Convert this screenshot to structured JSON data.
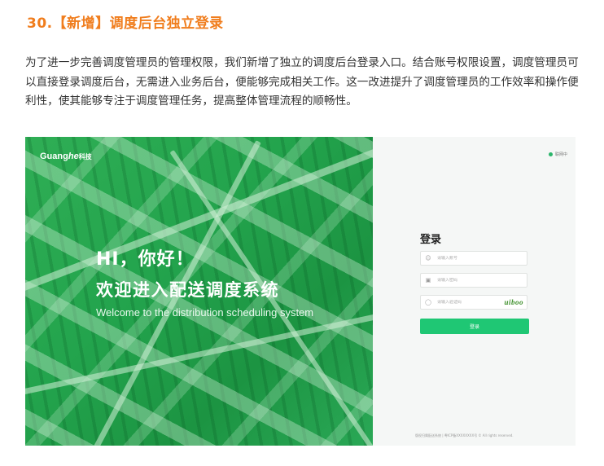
{
  "section": {
    "title": "30.【新增】调度后台独立登录",
    "intro": "为了进一步完善调度管理员的管理权限，我们新增了独立的调度后台登录入口。结合账号权限设置，调度管理员可以直接登录调度后台，无需进入业务后台，便能够完成相关工作。这一改进提升了调度管理员的工作效率和操作便利性，使其能够专注于调度管理任务，提高整体管理流程的顺畅性。"
  },
  "screenshot": {
    "logo": {
      "brand": "Guang",
      "he": "he",
      "suffix": "科技"
    },
    "hero": {
      "greeting": "HI，你好！",
      "headline": "欢迎进入配送调度系统",
      "subtitle": "Welcome to the distribution scheduling system"
    },
    "status_text": "联网中",
    "login": {
      "title": "登录",
      "account_placeholder": "请输入账号",
      "password_placeholder": "请输入密码",
      "captcha_placeholder": "请输入验证码",
      "captcha_code": "uiboo",
      "submit_label": "登录"
    },
    "footer": "版权归属配送系统 | 粤ICP备XXXXXXXX号 © All rights reserved.",
    "colors": {
      "accent_title": "#f07d1d",
      "hero_green": "#23a44d",
      "button_green": "#1fc774"
    }
  }
}
